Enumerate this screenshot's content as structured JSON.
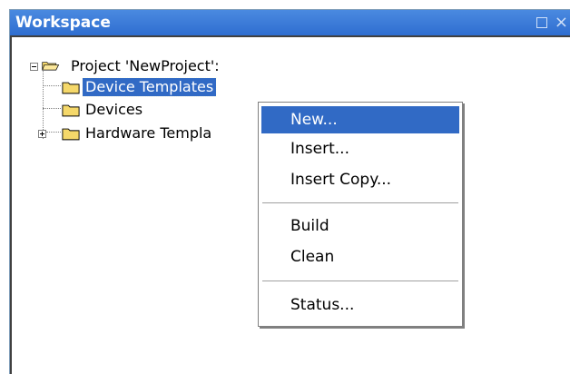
{
  "window": {
    "title": "Workspace",
    "close_glyph": "×"
  },
  "tree": {
    "root": {
      "label": "Project 'NewProject':",
      "icon": "open-folder-icon",
      "expanded": true
    },
    "children": [
      {
        "label": "Device Templates",
        "icon": "folder-icon",
        "selected": true
      },
      {
        "label": "Devices",
        "icon": "folder-icon"
      },
      {
        "label": "Hardware Templa",
        "icon": "folder-icon",
        "expandable": true
      }
    ]
  },
  "context_menu": {
    "items": [
      {
        "label": "New...",
        "highlighted": true
      },
      {
        "label": "Insert..."
      },
      {
        "label": "Insert Copy..."
      },
      {
        "label": "Build"
      },
      {
        "label": "Clean"
      },
      {
        "label": "Status..."
      }
    ]
  },
  "colors": {
    "titlebar": "#3e7fd6",
    "selection": "#316ac5",
    "folder": "#f5d86a"
  }
}
